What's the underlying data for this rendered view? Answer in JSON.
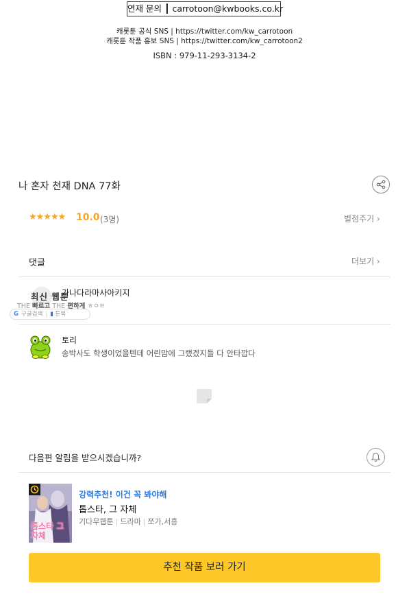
{
  "contact": {
    "text": "연재 문의 ┃ carrotoon@kwbooks.co.kr"
  },
  "sns": {
    "official": "캐롯툰 공식 SNS | https://twitter.com/kw_carrotoon",
    "promo": "캐롯툰 작품 홍보 SNS | https://twitter.com/kw_carrotoon2"
  },
  "isbn": "ISBN : 979-11-293-3134-2",
  "episode": {
    "title": "나 혼자 천재 DNA 77화"
  },
  "rating": {
    "stars": "★★★★★",
    "score": "10.0",
    "count": "(3명)",
    "rate_link": "별점주기 ›"
  },
  "comments": {
    "heading": "댓글",
    "more_link": "더보기 ›",
    "items": [
      {
        "name": "가나다라마사아키지"
      },
      {
        "name": "토리",
        "text": "송박사도 학생이었을텐데 어린맘에 그랬겠지들 다 안타깝다"
      }
    ]
  },
  "watermark": {
    "title": "최신 웹툰",
    "sub_fast": "빠르고",
    "sub_easy": "편하게",
    "sub_prefix1": "THE ",
    "sub_prefix2": " THE ",
    "sub_suffix": " ㅎㅇㅌ",
    "google_search": "구글검색",
    "toonbook": "툰북"
  },
  "notify": {
    "question": "다음편 알림을 받으시겠습니까?"
  },
  "recommend": {
    "tag": "강력추천! 이건 꼭 봐야해",
    "title": "톱스타, 그 자체",
    "meta1": "기다무웹툰",
    "meta2": "드라마",
    "meta3": "쪼가,서흥",
    "cover_text": "톱스타 그 자체",
    "cta": "추천 작품 보러 가기"
  },
  "colors": {
    "accent": "#fdc827",
    "star": "#f5a623",
    "tag_blue": "#2c7be5"
  }
}
